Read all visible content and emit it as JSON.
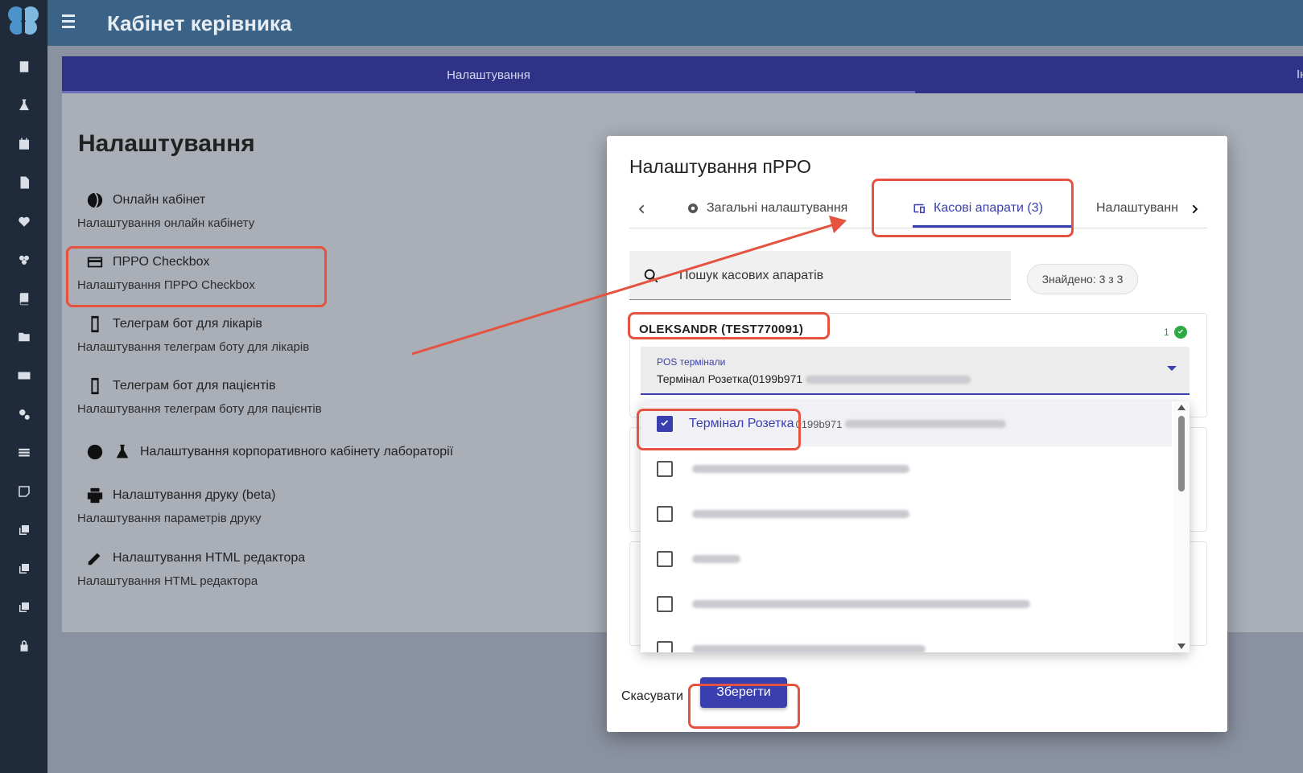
{
  "app": {
    "title": "Кабінет керівника"
  },
  "page_tabs": [
    "Налаштування",
    "Ін"
  ],
  "page": {
    "title": "Налаштування"
  },
  "settings": [
    {
      "title": "Онлайн кабінет",
      "sub": "Налаштування онлайн кабінету",
      "icon": "globe-icon"
    },
    {
      "title": "ПРРО Checkbox",
      "sub": "Налаштування ПРРО Checkbox",
      "icon": "credit-card-icon"
    },
    {
      "title": "Телеграм бот для лікарів",
      "sub": "Налаштування телеграм боту для лікарів",
      "icon": "phone-check-icon"
    },
    {
      "title": "Телеграм бот для пацієнтів",
      "sub": "Налаштування телеграм боту для пацієнтів",
      "icon": "phone-check-icon"
    },
    {
      "title": "Налаштування корпоративного кабінету лабораторії",
      "sub": "",
      "icon": "flask-icon"
    },
    {
      "title": "Налаштування друку (beta)",
      "sub": "Налаштування параметрів друку",
      "icon": "printer-icon"
    },
    {
      "title": "Налаштування HTML редактора",
      "sub": "Налаштування HTML редактора",
      "icon": "pencil-icon"
    }
  ],
  "modal": {
    "title": "Налаштування пРРО",
    "tabs": [
      "Загальні налаштування",
      "Касові апарати (3)",
      "Налаштуванн"
    ],
    "search_placeholder": "Пошук касових апаратів",
    "found": "Знайдено: 3 з 3",
    "cash_register": {
      "name": "OLEKSANDR (TEST770091)",
      "count": "1"
    },
    "select": {
      "label": "POS термінали",
      "value": "Термінал Розетка(0199b971"
    },
    "options": [
      {
        "label": "Термінал Розетка",
        "suffix": "0199b971",
        "checked": true
      }
    ],
    "cancel": "Скасувати",
    "save": "Зберегти"
  },
  "colors": {
    "accent": "#3a3fb0",
    "highlight": "#e5523f",
    "topbar": "#3a6387",
    "sidebar": "#1f2a3a"
  }
}
